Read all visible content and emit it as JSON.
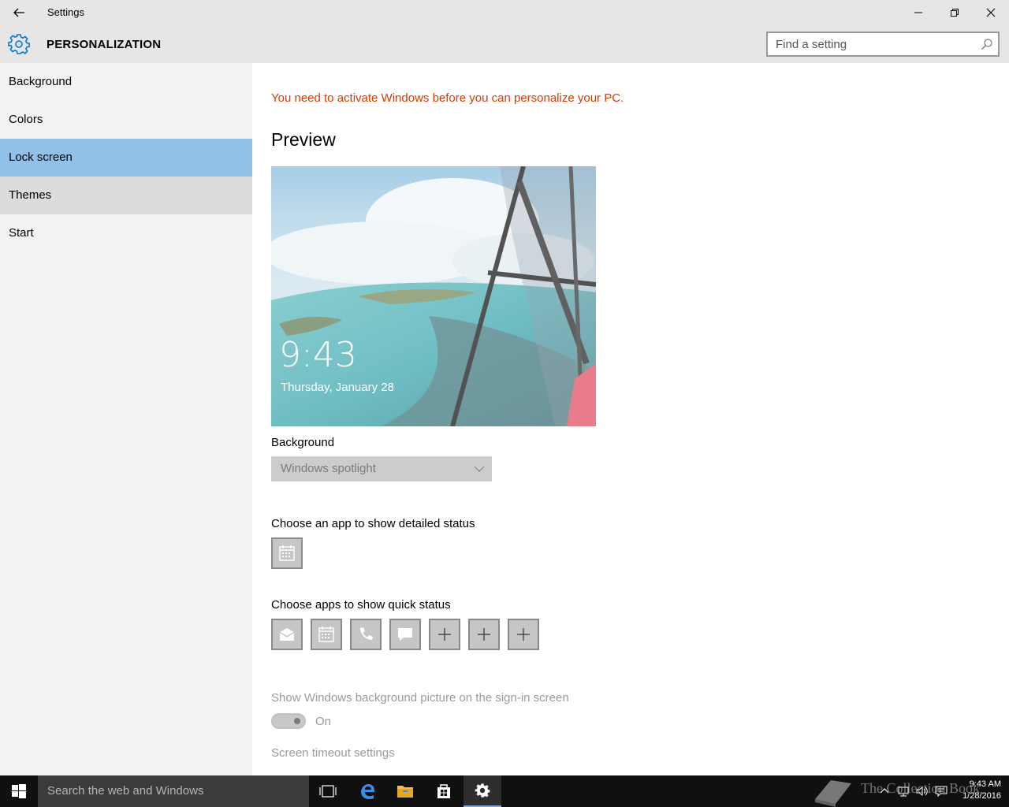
{
  "window": {
    "title": "Settings",
    "minimize_glyph": "—",
    "restore_glyph": "❐",
    "close_glyph": "✕"
  },
  "header": {
    "title": "PERSONALIZATION",
    "search_placeholder": "Find a setting",
    "accent": "#0078d7"
  },
  "sidebar": {
    "items": [
      {
        "label": "Background"
      },
      {
        "label": "Colors"
      },
      {
        "label": "Lock screen",
        "selected": true
      },
      {
        "label": "Themes"
      },
      {
        "label": "Start"
      }
    ],
    "selected_color": "#91c0e8"
  },
  "main": {
    "activation_warning": "You need to activate Windows before you can personalize your PC.",
    "warning_color": "#d83b01",
    "preview_heading": "Preview",
    "preview": {
      "time": "9:43",
      "date": "Thursday, January 28"
    },
    "background_label": "Background",
    "background_value": "Windows spotlight",
    "detailed_status_label": "Choose an app to show detailed status",
    "detailed_status_app": "calendar-icon",
    "quick_status_label": "Choose apps to show quick status",
    "quick_status_apps": [
      "mail-icon",
      "calendar-icon",
      "phone-icon",
      "message-icon",
      "plus-icon",
      "plus-icon",
      "plus-icon"
    ],
    "signin_bg_label": "Show Windows background picture on the sign-in screen",
    "signin_bg_state": "On",
    "screen_timeout_link": "Screen timeout settings"
  },
  "taskbar": {
    "search_placeholder": "Search the web and Windows",
    "clock_time": "9:43 AM",
    "clock_date": "1/28/2016"
  },
  "watermark": {
    "text": "The Collection Book"
  }
}
